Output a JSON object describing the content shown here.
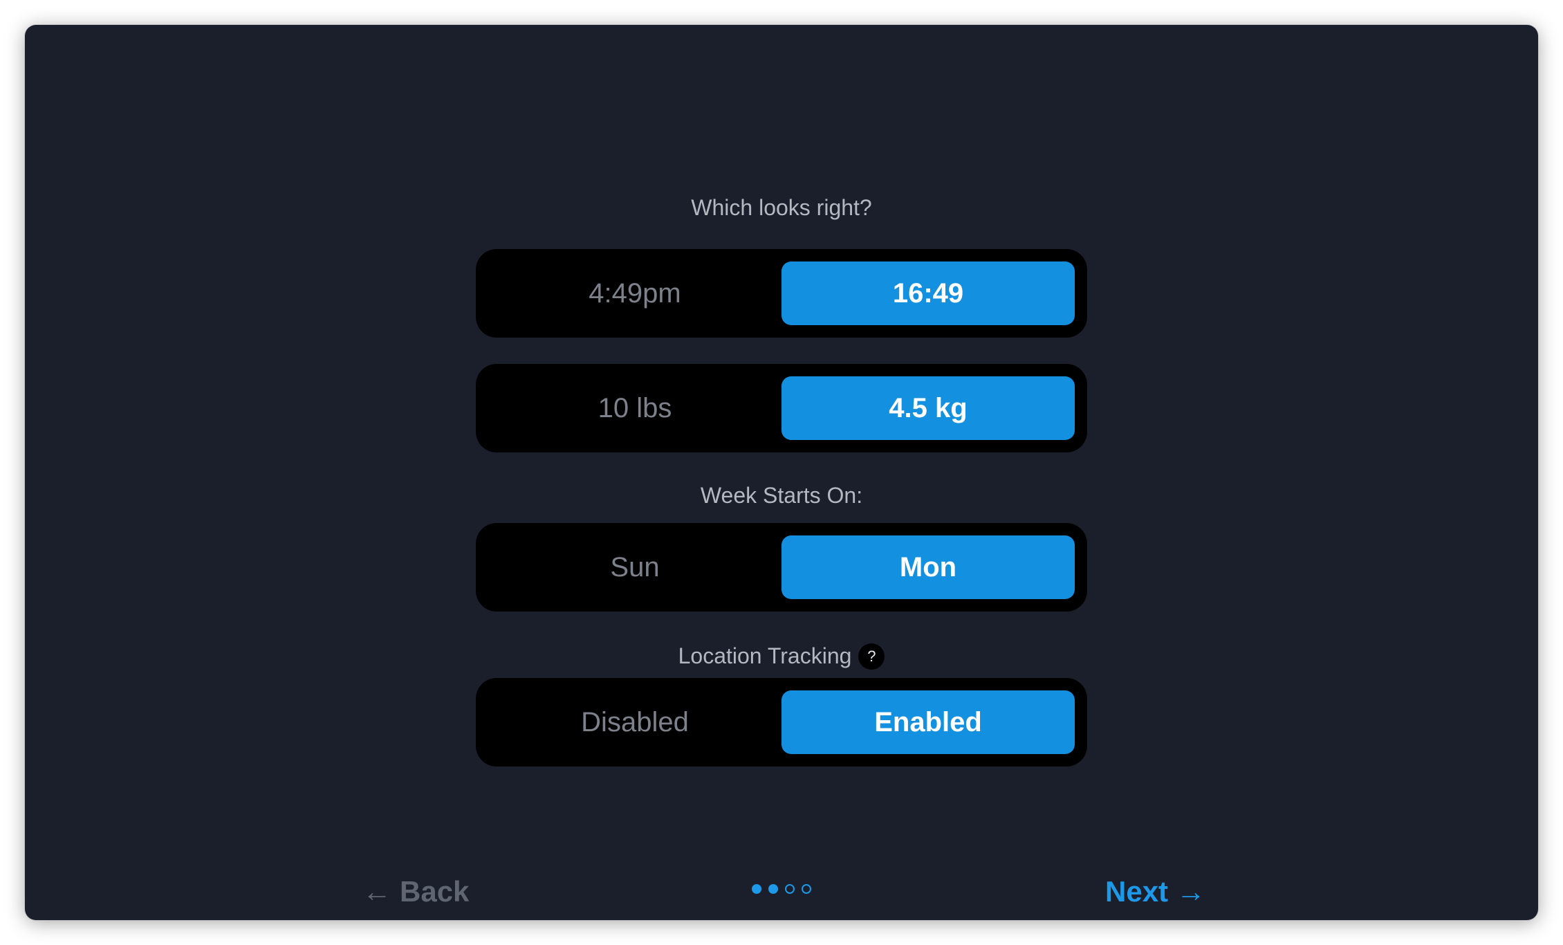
{
  "time_format": {
    "label": "Which looks right?",
    "options": [
      "4:49pm",
      "16:49"
    ],
    "selected": "16:49"
  },
  "weight_units": {
    "options": [
      "10 lbs",
      "4.5 kg"
    ],
    "selected": "4.5 kg"
  },
  "week_start": {
    "label": "Week Starts On:",
    "options": [
      "Sun",
      "Mon"
    ],
    "selected": "Mon"
  },
  "location_tracking": {
    "label": "Location Tracking",
    "help_glyph": "?",
    "options": [
      "Disabled",
      "Enabled"
    ],
    "selected": "Enabled"
  },
  "footer": {
    "back_label": "Back",
    "next_label": "Next",
    "back_arrow": "←",
    "next_arrow": "→",
    "pagination": {
      "total": 4,
      "filled": 2
    }
  },
  "colors": {
    "background": "#1a1f2b",
    "segment_bg": "#000000",
    "selected": "#1391e0",
    "accent": "#1e98e8",
    "muted_text": "#7c818b"
  }
}
